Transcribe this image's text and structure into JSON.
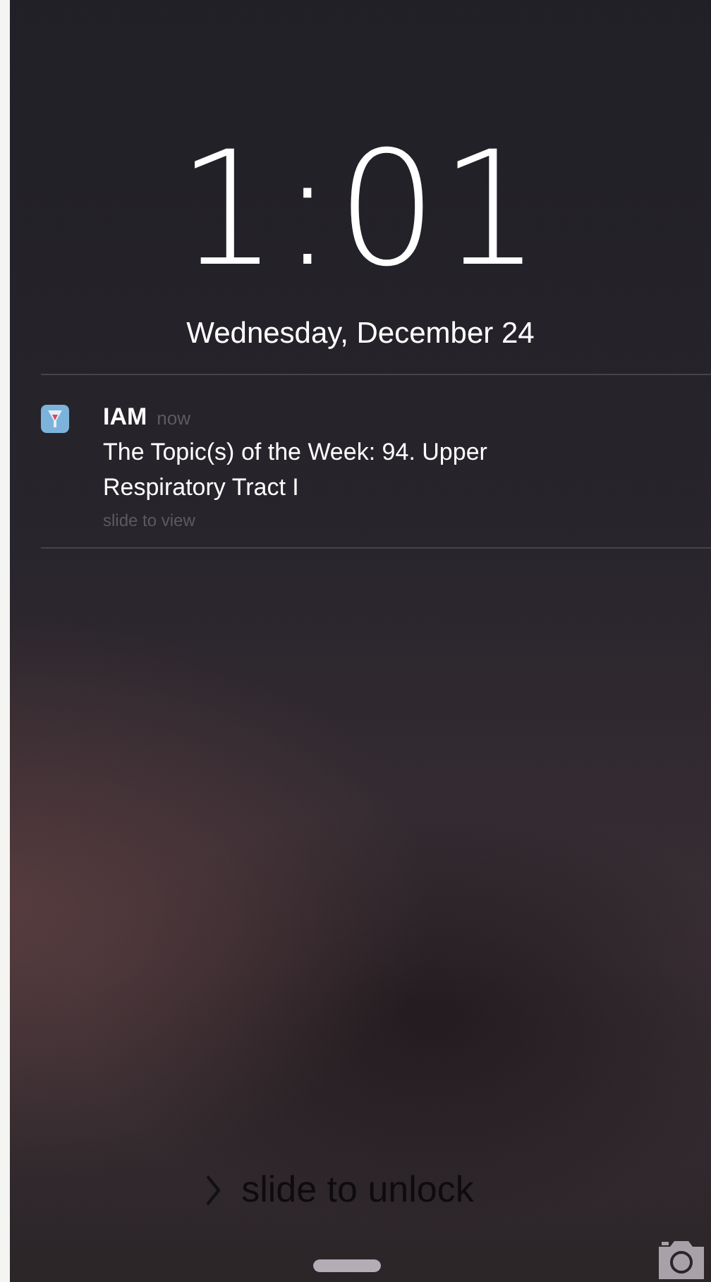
{
  "clock": {
    "time": "1:01",
    "date": "Wednesday, December 24"
  },
  "notifications": [
    {
      "app": "IAM",
      "time": "now",
      "message": "The Topic(s) of the Week: 94. Upper Respiratory Tract I",
      "action": "slide to view"
    }
  ],
  "unlock": {
    "label": "slide to unlock"
  }
}
